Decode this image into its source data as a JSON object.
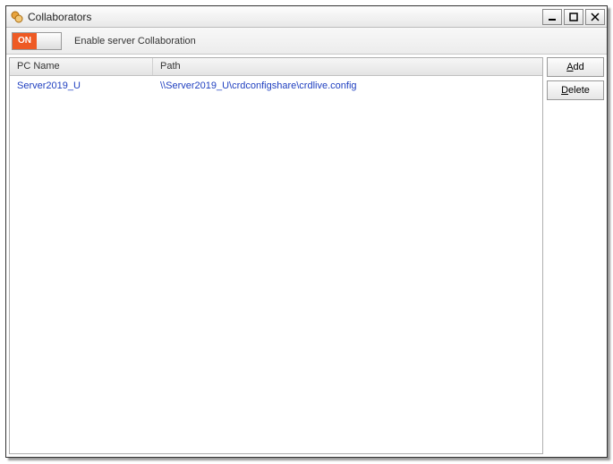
{
  "window": {
    "title": "Collaborators"
  },
  "toolbar": {
    "toggle_state": "ON",
    "label": "Enable server Collaboration"
  },
  "list": {
    "headers": {
      "pc": "PC Name",
      "path": "Path"
    },
    "rows": [
      {
        "pc": "Server2019_U",
        "path": "\\\\Server2019_U\\crdconfigshare\\crdlive.config"
      }
    ]
  },
  "buttons": {
    "add_prefix": "A",
    "add_rest": "dd",
    "delete_prefix": "D",
    "delete_rest": "elete"
  }
}
